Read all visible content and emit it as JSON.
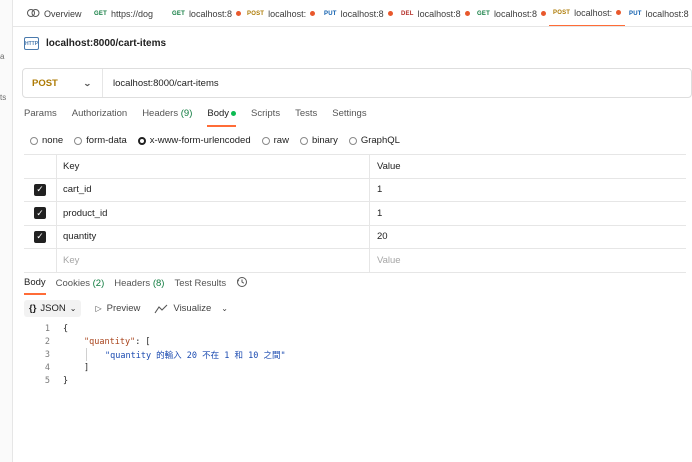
{
  "tabs": [
    {
      "method": "",
      "label": "Overview",
      "icon": "overview-icon",
      "dot": false
    },
    {
      "method": "GET",
      "label": "https://dog",
      "dot": false
    },
    {
      "method": "GET",
      "label": "localhost:8",
      "dot": true
    },
    {
      "method": "POST",
      "label": "localhost:",
      "dot": true
    },
    {
      "method": "PUT",
      "label": "localhost:8",
      "dot": true
    },
    {
      "method": "DEL",
      "label": "localhost:8",
      "dot": true
    },
    {
      "method": "GET",
      "label": "localhost:8",
      "dot": true
    },
    {
      "method": "POST",
      "label": "localhost:",
      "dot": true,
      "active": true
    },
    {
      "method": "PUT",
      "label": "localhost:8",
      "dot": false
    }
  ],
  "sidebar": {
    "fragments": [
      "a",
      "ts"
    ]
  },
  "request": {
    "icon_text": "HTTP",
    "title": "localhost:8000/cart-items",
    "method": "POST",
    "url": "localhost:8000/cart-items"
  },
  "request_tabs": [
    {
      "label": "Params"
    },
    {
      "label": "Authorization"
    },
    {
      "label": "Headers",
      "count": "(9)"
    },
    {
      "label": "Body",
      "active": true,
      "indicator": true
    },
    {
      "label": "Scripts"
    },
    {
      "label": "Tests"
    },
    {
      "label": "Settings"
    }
  ],
  "body_types": [
    {
      "label": "none",
      "selected": false
    },
    {
      "label": "form-data",
      "selected": false
    },
    {
      "label": "x-www-form-urlencoded",
      "selected": true
    },
    {
      "label": "raw",
      "selected": false
    },
    {
      "label": "binary",
      "selected": false
    },
    {
      "label": "GraphQL",
      "selected": false
    }
  ],
  "kv_table": {
    "headers": {
      "key": "Key",
      "value": "Value"
    },
    "rows": [
      {
        "key": "cart_id",
        "value": "1",
        "checked": true
      },
      {
        "key": "product_id",
        "value": "1",
        "checked": true
      },
      {
        "key": "quantity",
        "value": "20",
        "checked": true
      }
    ],
    "placeholder": {
      "key": "Key",
      "value": "Value"
    }
  },
  "response_tabs": [
    {
      "label": "Body",
      "active": true
    },
    {
      "label": "Cookies",
      "count": "(2)"
    },
    {
      "label": "Headers",
      "count": "(8)"
    },
    {
      "label": "Test Results"
    }
  ],
  "response_toolbar": {
    "format_icon": "{}",
    "format": "JSON",
    "preview": "Preview",
    "visualize": "Visualize"
  },
  "response_lines": [
    {
      "n": "1",
      "indent": 0,
      "parts": [
        {
          "t": "{",
          "c": "p"
        }
      ]
    },
    {
      "n": "2",
      "indent": 1,
      "parts": [
        {
          "t": "\"quantity\"",
          "c": "k"
        },
        {
          "t": ": [",
          "c": "p"
        }
      ]
    },
    {
      "n": "3",
      "indent": 2,
      "parts": [
        {
          "t": "\"quantity 的輸入 20 不在 1 和 10 之間\"",
          "c": "s"
        }
      ]
    },
    {
      "n": "4",
      "indent": 1,
      "parts": [
        {
          "t": "]",
          "c": "p"
        }
      ]
    },
    {
      "n": "5",
      "indent": 0,
      "parts": [
        {
          "t": "}",
          "c": "p"
        }
      ]
    }
  ],
  "colors": {
    "accent": "#ff6c37",
    "post": "#ad7a03",
    "get": "#0f7b3f",
    "put": "#0b5cad",
    "del": "#b32d26"
  }
}
